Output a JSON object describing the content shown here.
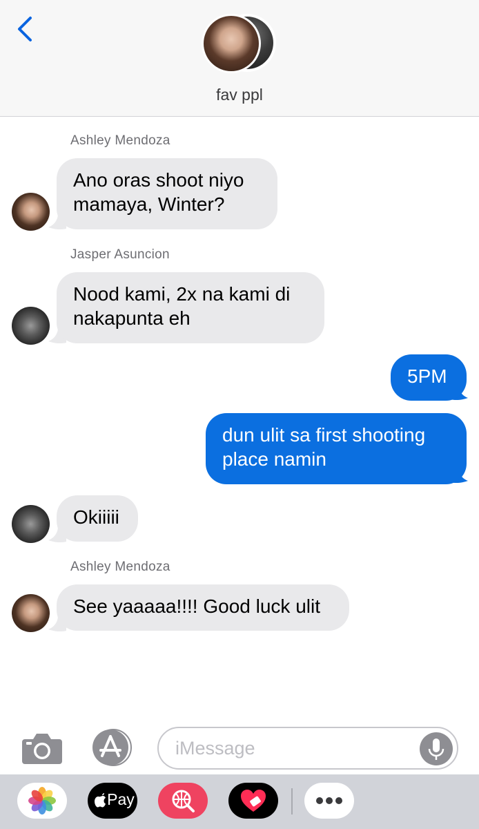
{
  "header": {
    "back_icon": "chevron-left-icon",
    "title": "fav ppl"
  },
  "messages": [
    {
      "sender": "Ashley Mendoza",
      "direction": "incoming",
      "text": "Ano oras shoot niyo\nmamaya, Winter?"
    },
    {
      "sender": "Jasper Asuncion",
      "direction": "incoming",
      "text": "Nood kami, 2x na kami di\nnakapunta eh"
    },
    {
      "sender": "",
      "direction": "outgoing",
      "text": "5PM"
    },
    {
      "sender": "",
      "direction": "outgoing",
      "text": "dun ulit sa first shooting\nplace namin"
    },
    {
      "sender": "",
      "direction": "incoming",
      "text": "Okiiiii"
    },
    {
      "sender": "Ashley Mendoza",
      "direction": "incoming",
      "text": "See yaaaaa!!!! Good luck ulit"
    }
  ],
  "input": {
    "placeholder": "iMessage",
    "camera_icon": "camera-icon",
    "appstore_icon": "app-store-icon",
    "mic_icon": "microphone-icon"
  },
  "drawer": {
    "apps": [
      {
        "name": "photos-app-icon"
      },
      {
        "name": "apple-pay-app-icon",
        "label": "Pay"
      },
      {
        "name": "web-search-app-icon"
      },
      {
        "name": "digital-touch-app-icon"
      },
      {
        "name": "more-apps-icon"
      }
    ]
  },
  "colors": {
    "outgoing_bubble": "#0b6fe0",
    "incoming_bubble": "#e9e9eb",
    "accent": "#0a64e0"
  }
}
